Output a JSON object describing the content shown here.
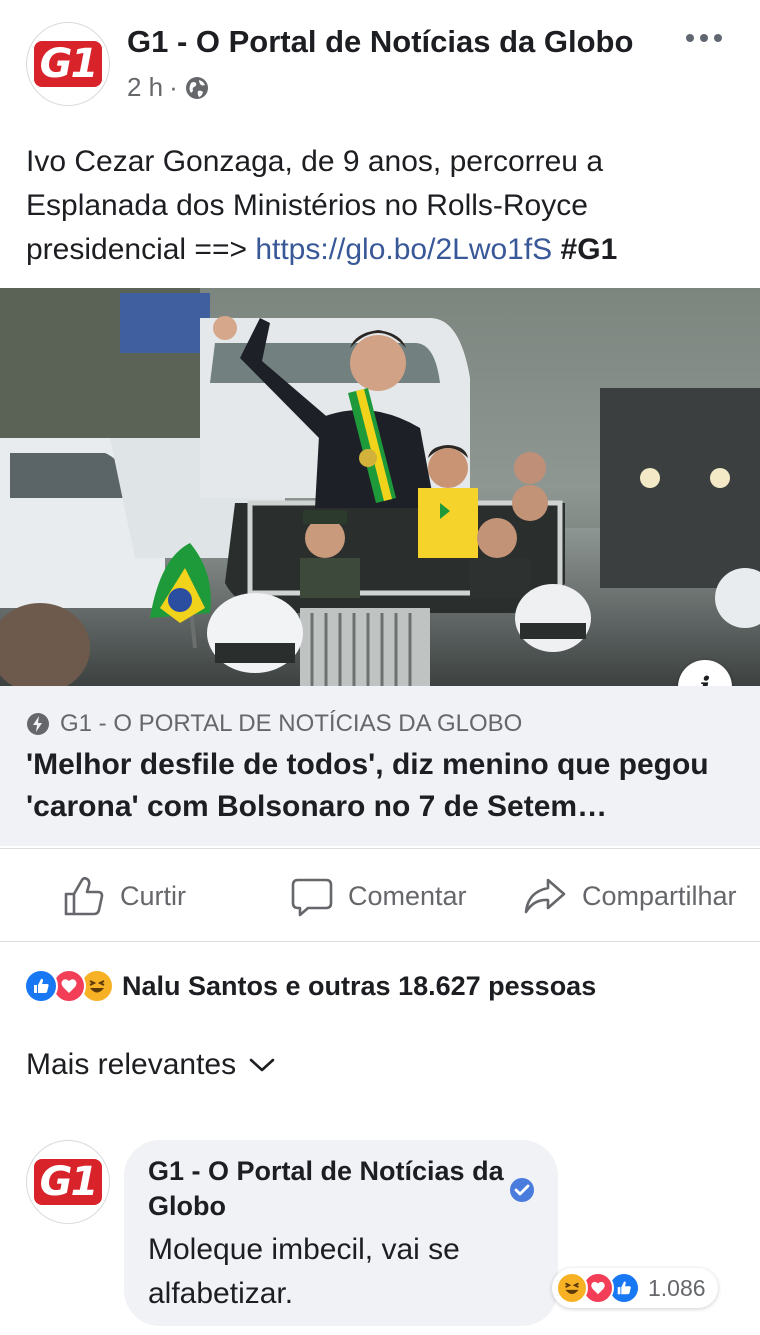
{
  "post": {
    "author": "G1 - O Portal de Notícias da Globo",
    "logo_text": "G1",
    "time": "2 h",
    "separator": "·",
    "privacy_icon": "globe-icon",
    "more_icon": "more-dots-icon",
    "text_main": "Ivo Cezar Gonzaga, de 9 anos, percorreu a Esplanada dos Ministérios no Rolls-Royce presidencial ==> ",
    "link": "https://glo.bo/2Lwo1fS",
    "hashtag": "#G1"
  },
  "preview": {
    "source": "G1 - O PORTAL DE NOTÍCIAS DA GLOBO",
    "title": "'Melhor desfile de todos', diz menino que pegou 'carona' com Bolsonaro no 7 de Setem…",
    "info_icon": "i"
  },
  "actions": {
    "like": "Curtir",
    "comment": "Comentar",
    "share": "Compartilhar"
  },
  "reactions": {
    "summary": "Nalu Santos e outras 18.627 pessoas",
    "types": [
      "like",
      "love",
      "haha"
    ]
  },
  "sort": {
    "label": "Mais relevantes"
  },
  "comment": {
    "author": "G1 - O Portal de Notícias da Globo",
    "logo_text": "G1",
    "text": "Moleque imbecil, vai se alfabetizar.",
    "reactions_count": "1.086",
    "reaction_types": [
      "haha",
      "love",
      "like"
    ]
  },
  "colors": {
    "link": "#385898",
    "like_blue": "#1877f2",
    "love_red": "#f33e58",
    "haha_yellow": "#f7b125",
    "brand_red": "#d8232a"
  }
}
